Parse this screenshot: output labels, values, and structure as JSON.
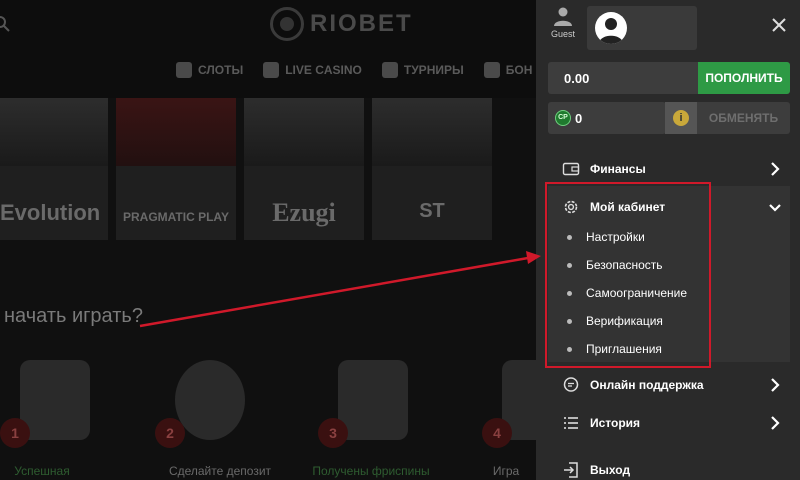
{
  "background_site": {
    "logo_text": "RIOBET",
    "nav": [
      {
        "label": "СЛОТЫ",
        "icon": "slot-machine-icon"
      },
      {
        "label": "LIVE CASINO",
        "icon": "dealer-icon"
      },
      {
        "label": "ТУРНИРЫ",
        "icon": "trophy-icon"
      },
      {
        "label": "БОН",
        "icon": "bonus-icon"
      }
    ],
    "providers": [
      "Evolution",
      "PRAGMATIC PLAY",
      "Ezugi",
      "ST"
    ],
    "how_to_title": "начать играть?",
    "steps": [
      {
        "num": "1",
        "label": "Успешная"
      },
      {
        "num": "2",
        "label": "Сделайте депозит"
      },
      {
        "num": "3",
        "label": "Получены фриспины"
      },
      {
        "num": "4",
        "label": "Игра"
      }
    ]
  },
  "panel": {
    "guest_label": "Guest",
    "balance": "0.00",
    "deposit_label": "ПОПОЛНИТЬ",
    "cp_icon_text": "CP",
    "cp_value": "0",
    "info_icon_text": "i",
    "exchange_label": "ОБМЕНЯТЬ",
    "menu": {
      "finance": "Финансы",
      "cabinet": "Мой кабинет",
      "support": "Онлайн поддержка",
      "history": "История",
      "logout": "Выход"
    },
    "cabinet_items": [
      "Настройки",
      "Безопасность",
      "Самоограничение",
      "Верификация",
      "Приглашения"
    ]
  },
  "colors": {
    "deposit_green": "#2e9a45",
    "highlight_red": "#d0192a",
    "panel_bg": "#2a2a2a",
    "submenu_bg": "#333333"
  }
}
